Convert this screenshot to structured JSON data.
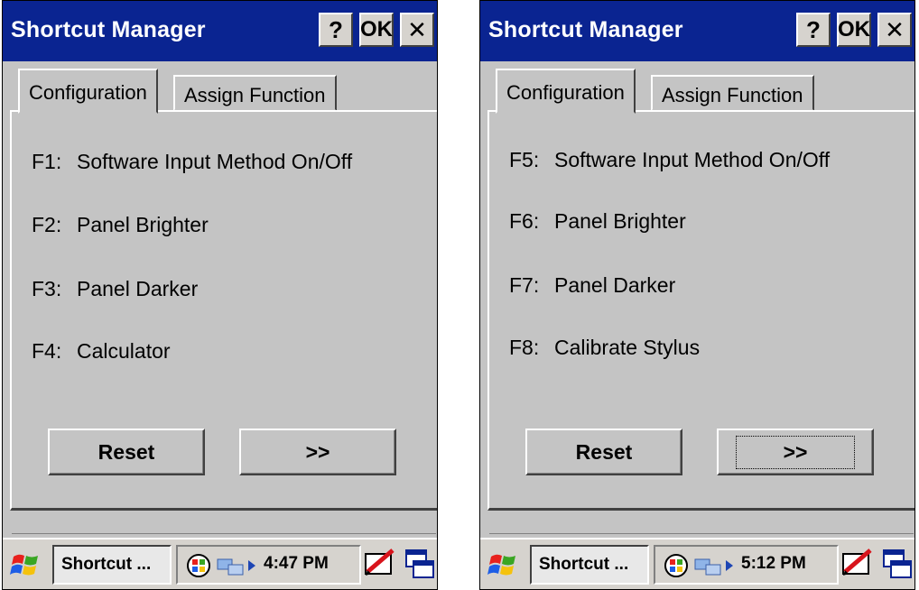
{
  "screens": [
    {
      "title": "Shortcut Manager",
      "title_buttons": {
        "help": "?",
        "ok": "OK",
        "close": "✕"
      },
      "tabs": [
        "Configuration",
        "Assign Function"
      ],
      "active_tab": "Configuration",
      "functions": [
        {
          "key": "F1:",
          "label": "Software Input Method On/Off"
        },
        {
          "key": "F2:",
          "label": "Panel Brighter"
        },
        {
          "key": "F3:",
          "label": "Panel Darker"
        },
        {
          "key": "F4:",
          "label": "Calculator"
        }
      ],
      "buttons": {
        "reset": "Reset",
        "next": ">>"
      },
      "taskbar": {
        "task_label": "Shortcut ...",
        "time": "4:47 PM"
      }
    },
    {
      "title": "Shortcut Manager",
      "title_buttons": {
        "help": "?",
        "ok": "OK",
        "close": "✕"
      },
      "tabs": [
        "Configuration",
        "Assign Function"
      ],
      "active_tab": "Configuration",
      "functions": [
        {
          "key": "F5:",
          "label": "Software Input Method On/Off"
        },
        {
          "key": "F6:",
          "label": "Panel Brighter"
        },
        {
          "key": "F7:",
          "label": "Panel Darker"
        },
        {
          "key": "F8:",
          "label": "Calibrate Stylus"
        }
      ],
      "buttons": {
        "reset": "Reset",
        "next": ">>"
      },
      "taskbar": {
        "task_label": "Shortcut ...",
        "time": "5:12 PM"
      }
    }
  ],
  "colors": {
    "title_bar": "#0a2491",
    "window_bg": "#c4c4c4",
    "taskbar_bg": "#d6d3ce"
  },
  "icons": [
    "windows-start-icon",
    "network-icon",
    "connection-icon",
    "pen-input-icon",
    "desktop-switch-icon"
  ]
}
